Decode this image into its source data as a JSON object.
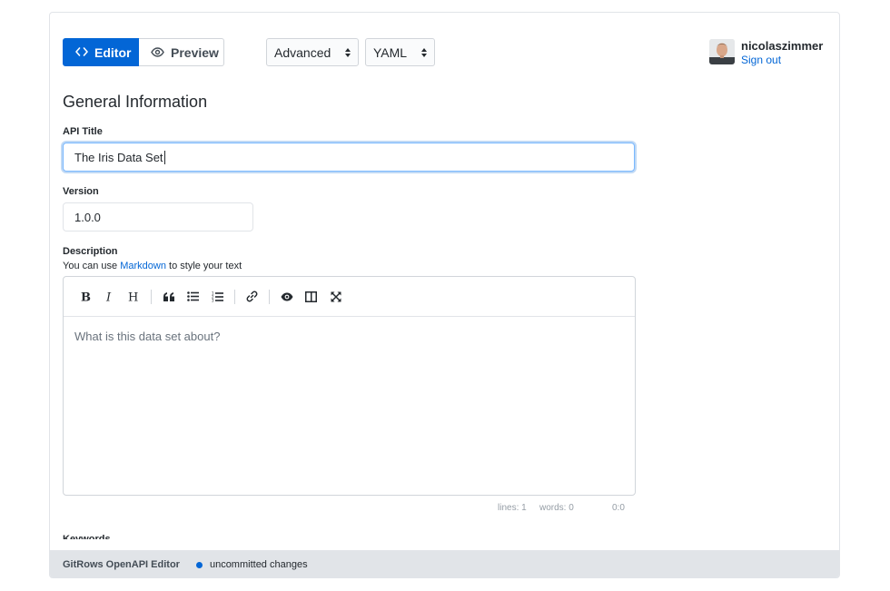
{
  "toolbar": {
    "editor_tab": "Editor",
    "preview_tab": "Preview",
    "mode_select": "Advanced",
    "format_select": "YAML",
    "accent_color": "#0366d6"
  },
  "user": {
    "name": "nicolaszimmer",
    "sign_out": "Sign out"
  },
  "form": {
    "section_title": "General Information",
    "api_title_label": "API Title",
    "api_title_value": "The Iris Data Set",
    "version_label": "Version",
    "version_value": "1.0.0",
    "description_label": "Description",
    "description_help_prefix": "You can use",
    "description_help_link": "Markdown",
    "description_help_suffix": "to style your text",
    "description_placeholder": "What is this data set about?",
    "keywords_label": "Keywords"
  },
  "markdown_toolbar": [
    "bold-icon",
    "italic-icon",
    "heading-icon",
    "quote-icon",
    "unordered-list-icon",
    "ordered-list-icon",
    "link-icon",
    "preview-icon",
    "side-by-side-icon",
    "fullscreen-icon"
  ],
  "status": {
    "lines": "lines: 1",
    "words": "words: 0",
    "cursor": "0:0"
  },
  "footer": {
    "brand": "GitRows OpenAPI Editor",
    "status": "uncommitted changes"
  }
}
